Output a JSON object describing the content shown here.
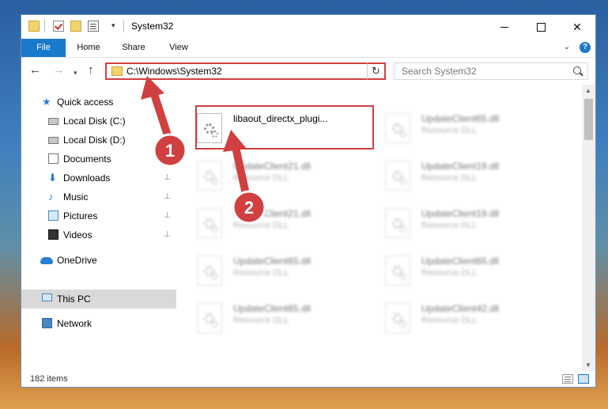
{
  "window": {
    "title": "System32",
    "controls": {
      "minimize_icon": "minimize-icon",
      "maximize_icon": "maximize-icon",
      "close_icon": "close-icon",
      "close_glyph": "✕"
    }
  },
  "quick_access_toolbar": {
    "items": [
      "folder-icon",
      "properties-check-icon",
      "new-folder-icon",
      "properties-icon"
    ],
    "dropdown_glyph": "▾"
  },
  "ribbon": {
    "tabs": [
      {
        "label": "File",
        "active": true
      },
      {
        "label": "Home"
      },
      {
        "label": "Share"
      },
      {
        "label": "View"
      }
    ],
    "expand_glyph": "⌄",
    "help_glyph": "?"
  },
  "navigation": {
    "back_glyph": "←",
    "forward_glyph": "→",
    "recent_glyph": "▾",
    "up_glyph": "↑",
    "address": "C:\\Windows\\System32",
    "address_dropdown_glyph": "⌄",
    "refresh_glyph": "↻",
    "search_placeholder": "Search System32"
  },
  "sidebar": {
    "quick_access": "Quick access",
    "items": [
      {
        "label": "Local Disk (C:)",
        "icon": "disk-icon",
        "pinned": false
      },
      {
        "label": "Local Disk (D:)",
        "icon": "disk-icon",
        "pinned": false
      },
      {
        "label": "Documents",
        "icon": "documents-icon",
        "pinned": true
      },
      {
        "label": "Downloads",
        "icon": "downloads-icon",
        "pinned": true
      },
      {
        "label": "Music",
        "icon": "music-icon",
        "pinned": true
      },
      {
        "label": "Pictures",
        "icon": "pictures-icon",
        "pinned": true
      },
      {
        "label": "Videos",
        "icon": "videos-icon",
        "pinned": true
      }
    ],
    "pin_glyph": "📌",
    "onedrive": "OneDrive",
    "this_pc": "This PC",
    "network": "Network"
  },
  "files": [
    {
      "name": "libaout_directx_plugi...",
      "type": "",
      "highlighted": true
    },
    {
      "name": "UpdateClient65.dll",
      "type": "Resource DLL"
    },
    {
      "name": "UpdateClient21.dll",
      "type": "Resource DLL"
    },
    {
      "name": "UpdateClient19.dll",
      "type": "Resource DLL"
    },
    {
      "name": "UpdateClient21.dll",
      "type": "Resource DLL"
    },
    {
      "name": "UpdateClient19.dll",
      "type": "Resource DLL"
    },
    {
      "name": "UpdateClient65.dll",
      "type": "Resource DLL"
    },
    {
      "name": "UpdateClient65.dll",
      "type": "Resource DLL"
    },
    {
      "name": "UpdateClient65.dll",
      "type": "Resource DLL"
    },
    {
      "name": "UpdateClient42.dll",
      "type": "Resource DLL"
    }
  ],
  "scrollbar": {
    "up_glyph": "▲",
    "down_glyph": "▼"
  },
  "status": {
    "item_count": "182 items"
  },
  "annotations": {
    "step1": "1",
    "step2": "2",
    "color": "#d04040"
  },
  "colors": {
    "accent": "#1979ca",
    "highlight": "#d04040",
    "folder": "#f3d46c"
  }
}
